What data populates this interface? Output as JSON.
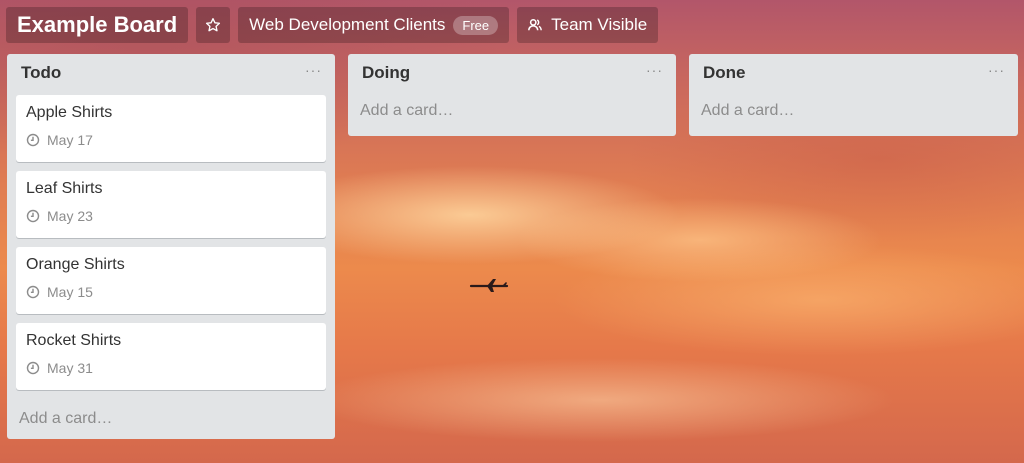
{
  "header": {
    "board_title": "Example Board",
    "star_icon": "star-icon",
    "org_name": "Web Development Clients",
    "org_badge": "Free",
    "visibility_label": "Team Visible",
    "visibility_icon": "team-icon"
  },
  "colors": {
    "list_bg": "#e2e4e6",
    "card_bg": "#ffffff",
    "text": "#333333",
    "muted_text": "#8c8c8c"
  },
  "lists": [
    {
      "title": "Todo",
      "menu": "···",
      "cards": [
        {
          "title": "Apple Shirts",
          "due": "May 17"
        },
        {
          "title": "Leaf Shirts",
          "due": "May 23"
        },
        {
          "title": "Orange Shirts",
          "due": "May 15"
        },
        {
          "title": "Rocket Shirts",
          "due": "May 31"
        }
      ],
      "add_card": "Add a card…"
    },
    {
      "title": "Doing",
      "menu": "···",
      "cards": [],
      "add_card": "Add a card…"
    },
    {
      "title": "Done",
      "menu": "···",
      "cards": [],
      "add_card": "Add a card…"
    }
  ]
}
